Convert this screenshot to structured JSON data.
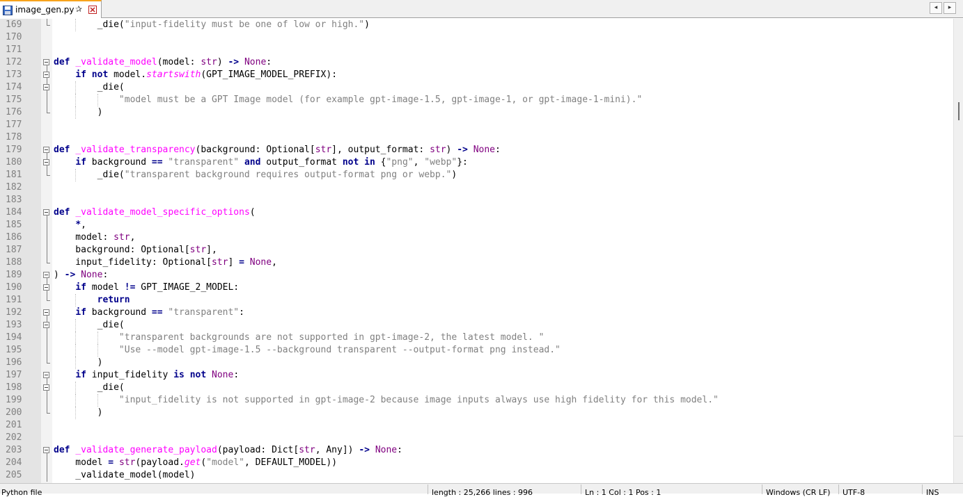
{
  "tab": {
    "filename": "image_gen.py",
    "pin_glyph": "✰"
  },
  "nav": {
    "left": "◂",
    "right": "▸"
  },
  "status": {
    "file_type": "Python file",
    "length_lines": "length : 25,266    lines : 996",
    "position": "Ln : 1    Col : 1    Pos : 1",
    "eol": "Windows (CR LF)",
    "encoding": "UTF-8",
    "mode": "INS"
  },
  "lines": [
    {
      "n": "169",
      "fold": "end",
      "tokens": [
        [
          "tx",
          "        _die("
        ],
        [
          "str",
          "\"input-fidelity must be one of low or high.\""
        ],
        [
          "tx",
          ")"
        ]
      ]
    },
    {
      "n": "170",
      "fold": "none",
      "tokens": []
    },
    {
      "n": "171",
      "fold": "none",
      "tokens": []
    },
    {
      "n": "172",
      "fold": "box",
      "tokens": [
        [
          "kw",
          "def"
        ],
        [
          "tx",
          " "
        ],
        [
          "fn",
          "_validate_model"
        ],
        [
          "tx",
          "(model: "
        ],
        [
          "bi",
          "str"
        ],
        [
          "tx",
          ") "
        ],
        [
          "op",
          "->"
        ],
        [
          "tx",
          " "
        ],
        [
          "bi",
          "None"
        ],
        [
          "tx",
          ":"
        ]
      ]
    },
    {
      "n": "173",
      "fold": "box",
      "tokens": [
        [
          "tx",
          "    "
        ],
        [
          "kw",
          "if"
        ],
        [
          "tx",
          " "
        ],
        [
          "kw",
          "not"
        ],
        [
          "tx",
          " model."
        ],
        [
          "it",
          "startswith"
        ],
        [
          "tx",
          "(GPT_IMAGE_MODEL_PREFIX):"
        ]
      ]
    },
    {
      "n": "174",
      "fold": "box",
      "tokens": [
        [
          "tx",
          "        _die("
        ]
      ]
    },
    {
      "n": "175",
      "fold": "mid",
      "tokens": [
        [
          "tx",
          "            "
        ],
        [
          "str",
          "\"model must be a GPT Image model (for example gpt-image-1.5, gpt-image-1, or gpt-image-1-mini).\""
        ]
      ]
    },
    {
      "n": "176",
      "fold": "end",
      "tokens": [
        [
          "tx",
          "        )"
        ]
      ]
    },
    {
      "n": "177",
      "fold": "none",
      "tokens": []
    },
    {
      "n": "178",
      "fold": "none",
      "tokens": []
    },
    {
      "n": "179",
      "fold": "box",
      "tokens": [
        [
          "kw",
          "def"
        ],
        [
          "tx",
          " "
        ],
        [
          "fn",
          "_validate_transparency"
        ],
        [
          "tx",
          "(background: Optional["
        ],
        [
          "bi",
          "str"
        ],
        [
          "tx",
          "], output_format: "
        ],
        [
          "bi",
          "str"
        ],
        [
          "tx",
          ") "
        ],
        [
          "op",
          "->"
        ],
        [
          "tx",
          " "
        ],
        [
          "bi",
          "None"
        ],
        [
          "tx",
          ":"
        ]
      ]
    },
    {
      "n": "180",
      "fold": "box",
      "tokens": [
        [
          "tx",
          "    "
        ],
        [
          "kw",
          "if"
        ],
        [
          "tx",
          " background "
        ],
        [
          "op",
          "=="
        ],
        [
          "tx",
          " "
        ],
        [
          "str",
          "\"transparent\""
        ],
        [
          "tx",
          " "
        ],
        [
          "kw",
          "and"
        ],
        [
          "tx",
          " output_format "
        ],
        [
          "kw",
          "not"
        ],
        [
          "tx",
          " "
        ],
        [
          "kw",
          "in"
        ],
        [
          "tx",
          " {"
        ],
        [
          "str",
          "\"png\""
        ],
        [
          "tx",
          ", "
        ],
        [
          "str",
          "\"webp\""
        ],
        [
          "tx",
          "}:"
        ]
      ]
    },
    {
      "n": "181",
      "fold": "end",
      "tokens": [
        [
          "tx",
          "        _die("
        ],
        [
          "str",
          "\"transparent background requires output-format png or webp.\""
        ],
        [
          "tx",
          ")"
        ]
      ]
    },
    {
      "n": "182",
      "fold": "none",
      "tokens": []
    },
    {
      "n": "183",
      "fold": "none",
      "tokens": []
    },
    {
      "n": "184",
      "fold": "box",
      "tokens": [
        [
          "kw",
          "def"
        ],
        [
          "tx",
          " "
        ],
        [
          "fn",
          "_validate_model_specific_options"
        ],
        [
          "tx",
          "("
        ]
      ]
    },
    {
      "n": "185",
      "fold": "mid",
      "tokens": [
        [
          "tx",
          "    "
        ],
        [
          "op",
          "*"
        ],
        [
          "tx",
          ","
        ]
      ]
    },
    {
      "n": "186",
      "fold": "mid",
      "tokens": [
        [
          "tx",
          "    model: "
        ],
        [
          "bi",
          "str"
        ],
        [
          "tx",
          ","
        ]
      ]
    },
    {
      "n": "187",
      "fold": "mid",
      "tokens": [
        [
          "tx",
          "    background: Optional["
        ],
        [
          "bi",
          "str"
        ],
        [
          "tx",
          "],"
        ]
      ]
    },
    {
      "n": "188",
      "fold": "end",
      "tokens": [
        [
          "tx",
          "    input_fidelity: Optional["
        ],
        [
          "bi",
          "str"
        ],
        [
          "tx",
          "] "
        ],
        [
          "op",
          "="
        ],
        [
          "tx",
          " "
        ],
        [
          "bi",
          "None"
        ],
        [
          "tx",
          ","
        ]
      ]
    },
    {
      "n": "189",
      "fold": "box",
      "tokens": [
        [
          "tx",
          ") "
        ],
        [
          "op",
          "->"
        ],
        [
          "tx",
          " "
        ],
        [
          "bi",
          "None"
        ],
        [
          "tx",
          ":"
        ]
      ]
    },
    {
      "n": "190",
      "fold": "box",
      "tokens": [
        [
          "tx",
          "    "
        ],
        [
          "kw",
          "if"
        ],
        [
          "tx",
          " model "
        ],
        [
          "op",
          "!="
        ],
        [
          "tx",
          " GPT_IMAGE_2_MODEL:"
        ]
      ]
    },
    {
      "n": "191",
      "fold": "end",
      "tokens": [
        [
          "tx",
          "        "
        ],
        [
          "kw",
          "return"
        ]
      ]
    },
    {
      "n": "192",
      "fold": "box",
      "tokens": [
        [
          "tx",
          "    "
        ],
        [
          "kw",
          "if"
        ],
        [
          "tx",
          " background "
        ],
        [
          "op",
          "=="
        ],
        [
          "tx",
          " "
        ],
        [
          "str",
          "\"transparent\""
        ],
        [
          "tx",
          ":"
        ]
      ]
    },
    {
      "n": "193",
      "fold": "box",
      "tokens": [
        [
          "tx",
          "        _die("
        ]
      ]
    },
    {
      "n": "194",
      "fold": "mid",
      "tokens": [
        [
          "tx",
          "            "
        ],
        [
          "str",
          "\"transparent backgrounds are not supported in gpt-image-2, the latest model. \""
        ]
      ]
    },
    {
      "n": "195",
      "fold": "mid",
      "tokens": [
        [
          "tx",
          "            "
        ],
        [
          "str",
          "\"Use --model gpt-image-1.5 --background transparent --output-format png instead.\""
        ]
      ]
    },
    {
      "n": "196",
      "fold": "end",
      "tokens": [
        [
          "tx",
          "        )"
        ]
      ]
    },
    {
      "n": "197",
      "fold": "box",
      "tokens": [
        [
          "tx",
          "    "
        ],
        [
          "kw",
          "if"
        ],
        [
          "tx",
          " input_fidelity "
        ],
        [
          "kw",
          "is"
        ],
        [
          "tx",
          " "
        ],
        [
          "kw",
          "not"
        ],
        [
          "tx",
          " "
        ],
        [
          "bi",
          "None"
        ],
        [
          "tx",
          ":"
        ]
      ]
    },
    {
      "n": "198",
      "fold": "box",
      "tokens": [
        [
          "tx",
          "        _die("
        ]
      ]
    },
    {
      "n": "199",
      "fold": "mid",
      "tokens": [
        [
          "tx",
          "            "
        ],
        [
          "str",
          "\"input_fidelity is not supported in gpt-image-2 because image inputs always use high fidelity for this model.\""
        ]
      ]
    },
    {
      "n": "200",
      "fold": "end",
      "tokens": [
        [
          "tx",
          "        )"
        ]
      ]
    },
    {
      "n": "201",
      "fold": "none",
      "tokens": []
    },
    {
      "n": "202",
      "fold": "none",
      "tokens": []
    },
    {
      "n": "203",
      "fold": "box",
      "tokens": [
        [
          "kw",
          "def"
        ],
        [
          "tx",
          " "
        ],
        [
          "fn",
          "_validate_generate_payload"
        ],
        [
          "tx",
          "(payload: Dict["
        ],
        [
          "bi",
          "str"
        ],
        [
          "tx",
          ", Any]) "
        ],
        [
          "op",
          "->"
        ],
        [
          "tx",
          " "
        ],
        [
          "bi",
          "None"
        ],
        [
          "tx",
          ":"
        ]
      ]
    },
    {
      "n": "204",
      "fold": "mid",
      "tokens": [
        [
          "tx",
          "    model "
        ],
        [
          "op",
          "="
        ],
        [
          "tx",
          " "
        ],
        [
          "bi",
          "str"
        ],
        [
          "tx",
          "(payload."
        ],
        [
          "it",
          "get"
        ],
        [
          "tx",
          "("
        ],
        [
          "str",
          "\"model\""
        ],
        [
          "tx",
          ", DEFAULT_MODEL))"
        ]
      ]
    },
    {
      "n": "205",
      "fold": "mid",
      "tokens": [
        [
          "tx",
          "    _validate_model(model)"
        ]
      ]
    }
  ]
}
